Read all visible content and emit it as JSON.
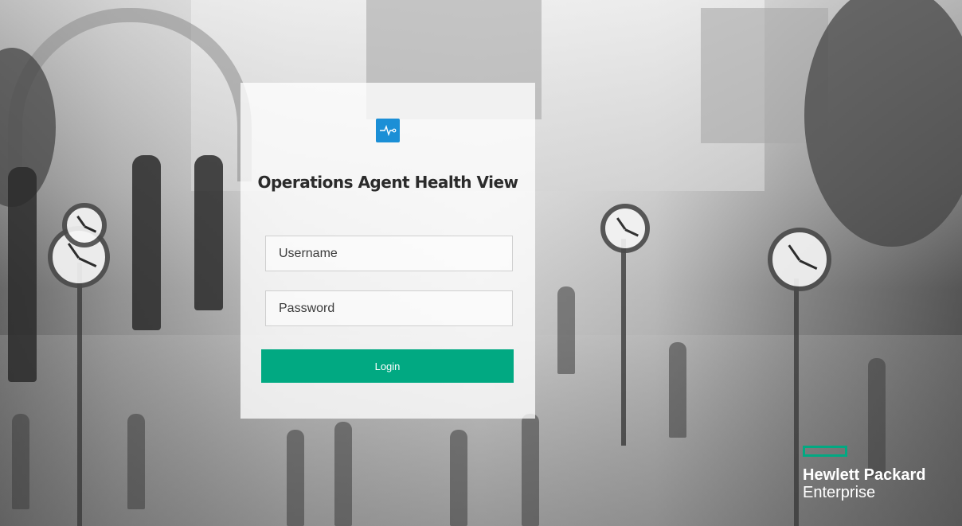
{
  "login": {
    "title": "Operations Agent Health View",
    "username_placeholder": "Username",
    "password_placeholder": "Password",
    "login_label": "Login"
  },
  "branding": {
    "app_icon": "pulse-monitor-icon",
    "company_line1": "Hewlett Packard",
    "company_line2": "Enterprise"
  },
  "colors": {
    "accent": "#01a982",
    "app_icon_bg": "#1b8fd6",
    "title_text": "#2b2b2b"
  }
}
